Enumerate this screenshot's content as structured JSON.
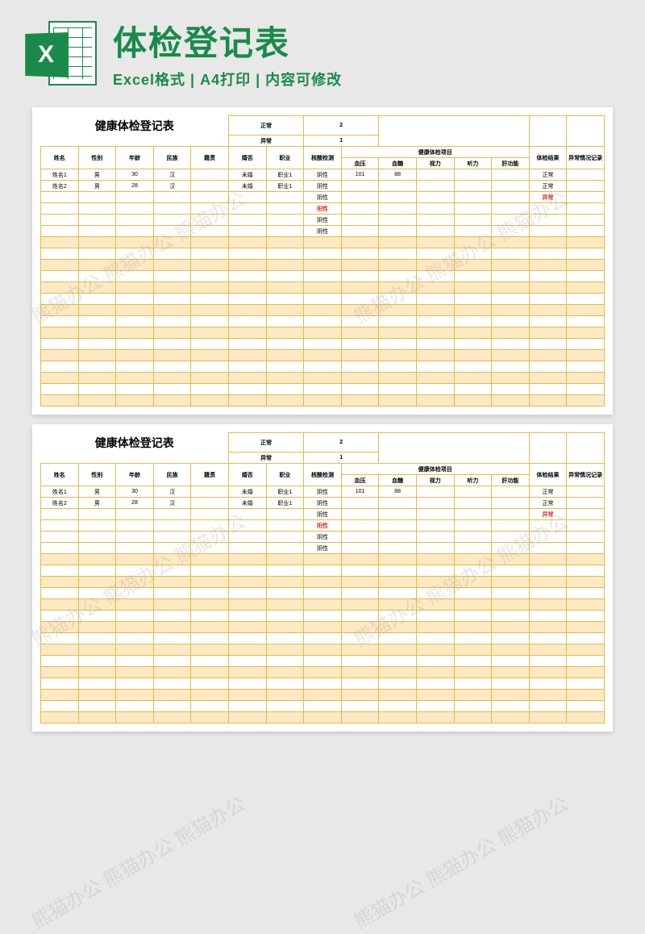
{
  "header": {
    "icon_letter": "X",
    "title": "体检登记表",
    "subtitle": "Excel格式 | A4打印 | 内容可修改"
  },
  "watermark": "熊猫办公 熊猫办公 熊猫办公",
  "sheet": {
    "title": "健康体检登记表",
    "stats": {
      "normal_label": "正常",
      "normal_value": "2",
      "abnormal_label": "异常",
      "abnormal_value": "1"
    },
    "headers": {
      "name": "姓名",
      "gender": "性别",
      "age": "年龄",
      "ethnicity": "民族",
      "origin": "籍贯",
      "marital": "婚否",
      "occupation": "职业",
      "test": "核酸检测",
      "health_items": "健康体检项目",
      "bp": "血压",
      "sugar": "血糖",
      "vision": "视力",
      "hearing": "听力",
      "liver": "肝功能",
      "result": "体检结果",
      "abnormal_record": "异常情况记录"
    },
    "rows": [
      {
        "name": "姓名1",
        "gender": "男",
        "age": "30",
        "ethnicity": "汉",
        "origin": "",
        "marital": "未婚",
        "occupation": "职业1",
        "test": "阴性",
        "bp": "101",
        "sugar": "88",
        "vision": "",
        "hearing": "",
        "liver": "",
        "result": "正常",
        "result_red": false
      },
      {
        "name": "姓名2",
        "gender": "男",
        "age": "28",
        "ethnicity": "汉",
        "origin": "",
        "marital": "未婚",
        "occupation": "职业1",
        "test": "阴性",
        "bp": "",
        "sugar": "",
        "vision": "",
        "hearing": "",
        "liver": "",
        "result": "正常",
        "result_red": false
      },
      {
        "name": "",
        "gender": "",
        "age": "",
        "ethnicity": "",
        "origin": "",
        "marital": "",
        "occupation": "",
        "test": "阴性",
        "bp": "",
        "sugar": "",
        "vision": "",
        "hearing": "",
        "liver": "",
        "result": "异常",
        "result_red": true
      },
      {
        "name": "",
        "gender": "",
        "age": "",
        "ethnicity": "",
        "origin": "",
        "marital": "",
        "occupation": "",
        "test": "阳性",
        "bp": "",
        "sugar": "",
        "vision": "",
        "hearing": "",
        "liver": "",
        "result": "",
        "result_red": false
      },
      {
        "name": "",
        "gender": "",
        "age": "",
        "ethnicity": "",
        "origin": "",
        "marital": "",
        "occupation": "",
        "test": "阴性",
        "bp": "",
        "sugar": "",
        "vision": "",
        "hearing": "",
        "liver": "",
        "result": "",
        "result_red": false
      },
      {
        "name": "",
        "gender": "",
        "age": "",
        "ethnicity": "",
        "origin": "",
        "marital": "",
        "occupation": "",
        "test": "阴性",
        "bp": "",
        "sugar": "",
        "vision": "",
        "hearing": "",
        "liver": "",
        "result": "",
        "result_red": false
      }
    ],
    "empty_rows": 15
  }
}
